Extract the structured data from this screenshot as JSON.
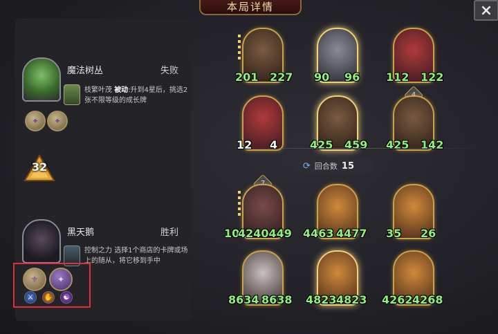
{
  "title": "本局详情",
  "close_icon": "×",
  "round": {
    "label": "回合数",
    "value": "15"
  },
  "tier_level": "32",
  "players": [
    {
      "name": "魔法树丛",
      "result": "失败",
      "power": {
        "name": "枝繁叶茂",
        "tag": "被动",
        "desc": ":升到4星后，挑选2张不限等级的成长牌"
      },
      "icons": [
        "coin-grape-icon",
        "coin-grape-icon"
      ]
    },
    {
      "name": "黑天鹅",
      "result": "胜利",
      "power": {
        "name": "控制之力",
        "desc": "选择1个商店的卡牌或场上的随从，将它移到手中"
      },
      "icons": [
        "coin-gold-icon",
        "coin-purple-icon",
        "mini-blue-icon",
        "mini-orange-icon",
        "mini-violet-icon"
      ]
    }
  ],
  "board_top": [
    {
      "atk": "201",
      "hp": "227",
      "style": "c-brown",
      "golden": false
    },
    {
      "atk": "90",
      "hp": "96",
      "style": "c-grey",
      "golden": true
    },
    {
      "atk": "112",
      "hp": "122",
      "style": "c-red",
      "golden": false
    },
    {
      "atk": "12",
      "hp": "4",
      "style": "c-red",
      "golden": false,
      "plain": true
    },
    {
      "atk": "425",
      "hp": "459",
      "style": "c-brown",
      "golden": true
    },
    {
      "atk": "425",
      "hp": "142",
      "style": "c-brown",
      "golden": false,
      "tier": "4"
    }
  ],
  "board_bottom": [
    {
      "atk": "10",
      "hp": "4240449",
      "style": "c-rat",
      "golden": false,
      "tier": "7"
    },
    {
      "atk": "4463",
      "hp": "4477",
      "style": "c-cat",
      "golden": false
    },
    {
      "atk": "35",
      "hp": "26",
      "style": "c-cat",
      "golden": false
    },
    {
      "atk": "8634",
      "hp": "8638",
      "style": "c-white",
      "golden": false
    },
    {
      "atk": "4823",
      "hp": "4823",
      "style": "c-cat",
      "golden": true
    },
    {
      "atk": "4262",
      "hp": "4268",
      "style": "c-cat",
      "golden": false
    }
  ]
}
